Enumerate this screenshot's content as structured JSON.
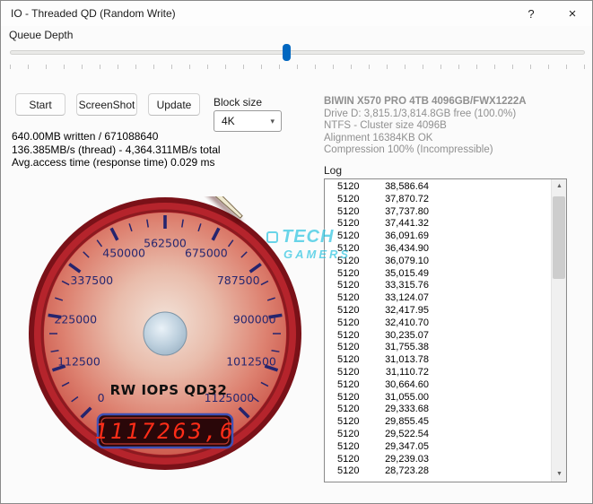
{
  "window": {
    "title": "IO - Threaded QD (Random Write)",
    "help_label": "?",
    "close_label": "×"
  },
  "queue_depth": {
    "label": "Queue Depth",
    "thumb_percent": 48
  },
  "toolbar": {
    "start_label": "Start",
    "screenshot_label": "ScreenShot",
    "update_label": "Update"
  },
  "block_size": {
    "label": "Block size",
    "selected": "4K",
    "chevron": "▾"
  },
  "drive_info": {
    "model": "BIWIN X570 PRO 4TB 4096GB/FWX1222A",
    "lines": [
      "Drive D: 3,815.1/3,814.8GB free (100.0%)",
      "NTFS - Cluster size 4096B",
      "Alignment 16384KB OK",
      "Compression 100% (Incompressible)"
    ]
  },
  "stats": {
    "line1": "640.00MB written / 671088640",
    "line2": "136.385MB/s (thread) - 4,364.311MB/s total",
    "line3": "Avg.access time (response time) 0.029 ms"
  },
  "log": {
    "label": "Log",
    "entries": [
      [
        "5120",
        "38,586.64"
      ],
      [
        "5120",
        "37,870.72"
      ],
      [
        "5120",
        "37,737.80"
      ],
      [
        "5120",
        "37,441.32"
      ],
      [
        "5120",
        "36,091.69"
      ],
      [
        "5120",
        "36,434.90"
      ],
      [
        "5120",
        "36,079.10"
      ],
      [
        "5120",
        "35,015.49"
      ],
      [
        "5120",
        "33,315.76"
      ],
      [
        "5120",
        "33,124.07"
      ],
      [
        "5120",
        "32,417.95"
      ],
      [
        "5120",
        "32,410.70"
      ],
      [
        "5120",
        "30,235.07"
      ],
      [
        "5120",
        "31,755.38"
      ],
      [
        "5120",
        "31,013.78"
      ],
      [
        "5120",
        "31,110.72"
      ],
      [
        "5120",
        "30,664.60"
      ],
      [
        "5120",
        "31,055.00"
      ],
      [
        "5120",
        "29,333.68"
      ],
      [
        "5120",
        "29,855.45"
      ],
      [
        "5120",
        "29,522.54"
      ],
      [
        "5120",
        "29,347.05"
      ],
      [
        "5120",
        "29,239.03"
      ],
      [
        "5120",
        "28,723.28"
      ]
    ]
  },
  "gauge": {
    "label": "RW IOPS QD32",
    "display": "1117263,6",
    "value": 1117263.6,
    "min": 0,
    "max": 1125000,
    "start_angle_deg": 225,
    "sweep_deg": 270,
    "scale_labels": [
      0,
      112500,
      225000,
      337500,
      450000,
      562500,
      675000,
      787500,
      900000,
      1012500,
      1125000
    ]
  },
  "watermark": {
    "line1": "TECH",
    "line2": "GAMERS"
  },
  "scrollbar": {
    "up": "▲",
    "down": "▼"
  }
}
